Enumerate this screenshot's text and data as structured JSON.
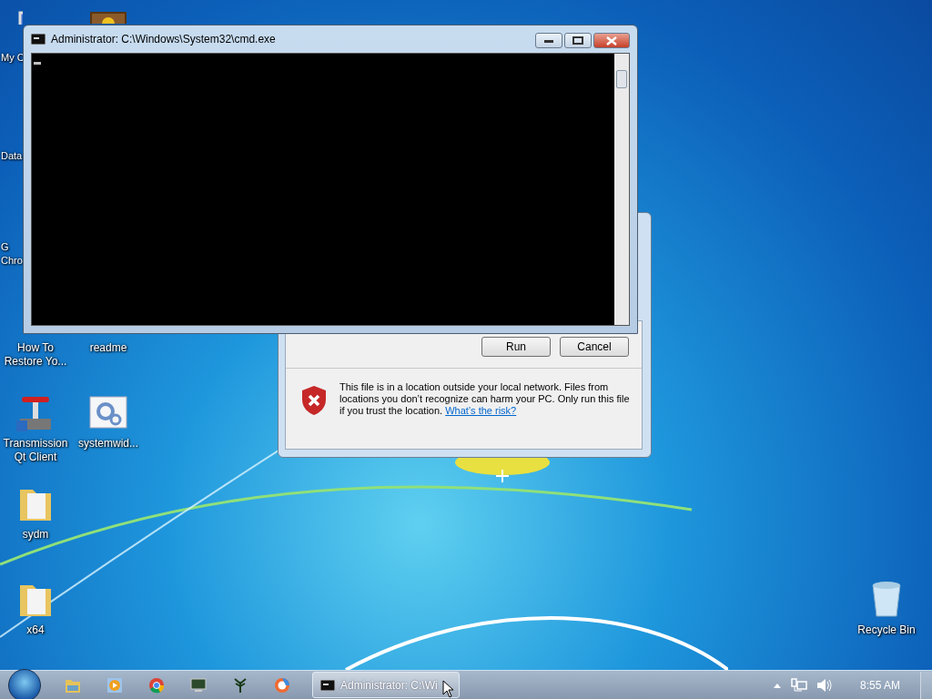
{
  "desktop_icons": [
    {
      "label": "My C",
      "kind": "computer"
    },
    {
      "kind": "chest"
    },
    {
      "label": "Data"
    },
    {
      "label": "G Chro"
    },
    {
      "label": "How To Restore Yo..."
    },
    {
      "label": "readme"
    },
    {
      "label": "Transmission Qt Client",
      "kind": "transmission"
    },
    {
      "label": "systemwid...",
      "kind": "settings"
    },
    {
      "label": "sydm",
      "kind": "folder"
    },
    {
      "label": "x64",
      "kind": "folder"
    },
    {
      "label": "Recycle Bin",
      "kind": "recycle"
    }
  ],
  "cmd_window": {
    "title": "Administrator: C:\\Windows\\System32\\cmd.exe"
  },
  "run_dialog": {
    "buttons": [
      "Run",
      "Cancel"
    ],
    "warning": "This file is in a location outside your local network. Files from locations you don’t recognize can harm your PC. Only run this file if you trust the location.",
    "link": "What’s the risk?"
  },
  "taskbar": {
    "pinned": [
      {
        "kind": "explorer"
      },
      {
        "kind": "media"
      },
      {
        "kind": "chrome"
      },
      {
        "kind": "monitor"
      },
      {
        "kind": "plant"
      },
      {
        "kind": "browser"
      }
    ],
    "active_task": {
      "label": "Administrator: C:\\Wi"
    },
    "clock": "8:55 AM"
  }
}
